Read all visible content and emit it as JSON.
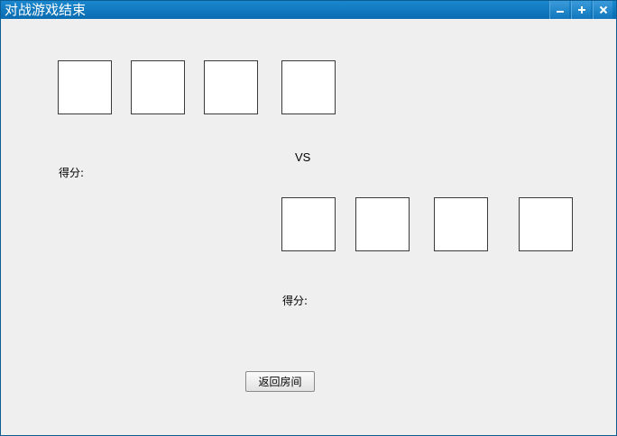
{
  "window": {
    "title": "对战游戏结束",
    "controls": {
      "minimize_icon": "minimize-icon",
      "maximize_icon": "maximize-icon",
      "close_icon": "close-icon"
    },
    "colors": {
      "titlebar": "#0a78c0",
      "background": "#efefef",
      "title_text": "#ffffff"
    }
  },
  "player1": {
    "score_label": "得分:",
    "cards_count": 4
  },
  "versus_label": "VS",
  "player2": {
    "score_label": "得分:",
    "cards_count": 4
  },
  "return_button_label": "返回房间"
}
